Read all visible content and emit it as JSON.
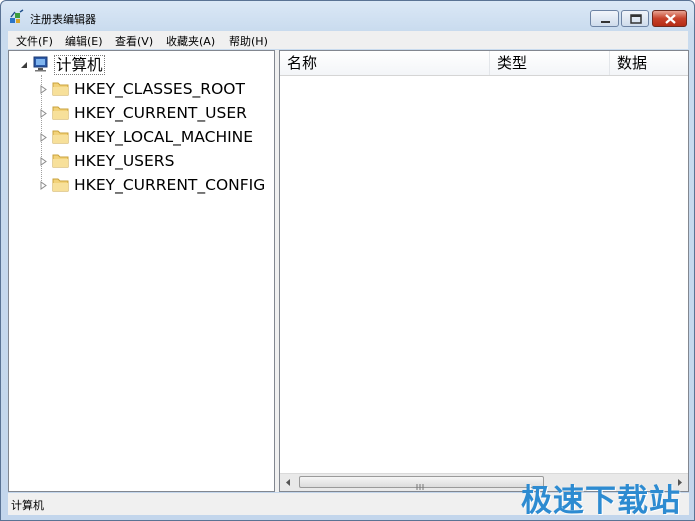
{
  "window": {
    "title": "注册表编辑器"
  },
  "menu": [
    {
      "label": "文件(F)"
    },
    {
      "label": "编辑(E)"
    },
    {
      "label": "查看(V)"
    },
    {
      "label": "收藏夹(A)"
    },
    {
      "label": "帮助(H)"
    }
  ],
  "tree": {
    "root": {
      "label": "计算机",
      "icon": "computer-icon",
      "expanded": true
    },
    "items": [
      {
        "label": "HKEY_CLASSES_ROOT",
        "icon": "folder-icon"
      },
      {
        "label": "HKEY_CURRENT_USER",
        "icon": "folder-icon"
      },
      {
        "label": "HKEY_LOCAL_MACHINE",
        "icon": "folder-icon"
      },
      {
        "label": "HKEY_USERS",
        "icon": "folder-icon"
      },
      {
        "label": "HKEY_CURRENT_CONFIG",
        "icon": "folder-icon"
      }
    ]
  },
  "list": {
    "columns": [
      {
        "label": "名称"
      },
      {
        "label": "类型"
      },
      {
        "label": "数据"
      }
    ],
    "rows": []
  },
  "status": {
    "text": "计算机"
  },
  "watermark": {
    "text": "极速下载站"
  },
  "colors": {
    "selection": "#3399ff",
    "accent": "#2d8bd1",
    "close": "#c7422b"
  }
}
